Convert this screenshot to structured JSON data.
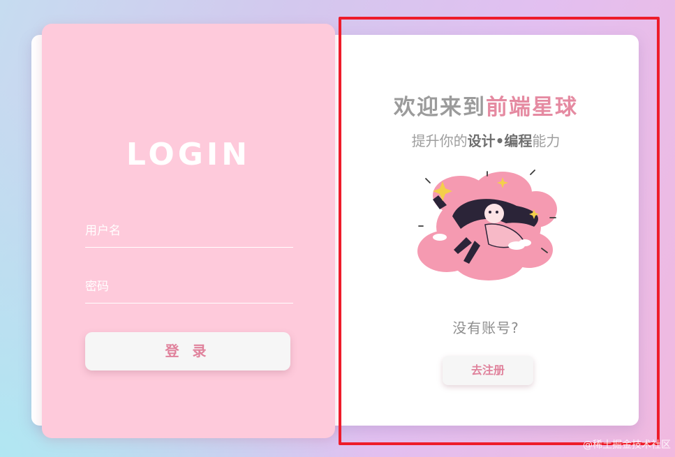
{
  "login": {
    "title": "LOGIN",
    "username_placeholder": "用户名",
    "password_placeholder": "密码",
    "submit_label": "登 录"
  },
  "welcome": {
    "title_prefix": "欢迎来到",
    "title_highlight": "前端星球",
    "subtitle_prefix": "提升你的",
    "subtitle_bold": "设计•编程",
    "subtitle_suffix": "能力"
  },
  "register": {
    "prompt": "没有账号?",
    "button_label": "去注册"
  },
  "watermark": "@稀土掘金技术社区",
  "colors": {
    "login_card": "#fecadb",
    "accent_pink": "#e58aa1",
    "highlight_red": "#ee1c2a"
  }
}
